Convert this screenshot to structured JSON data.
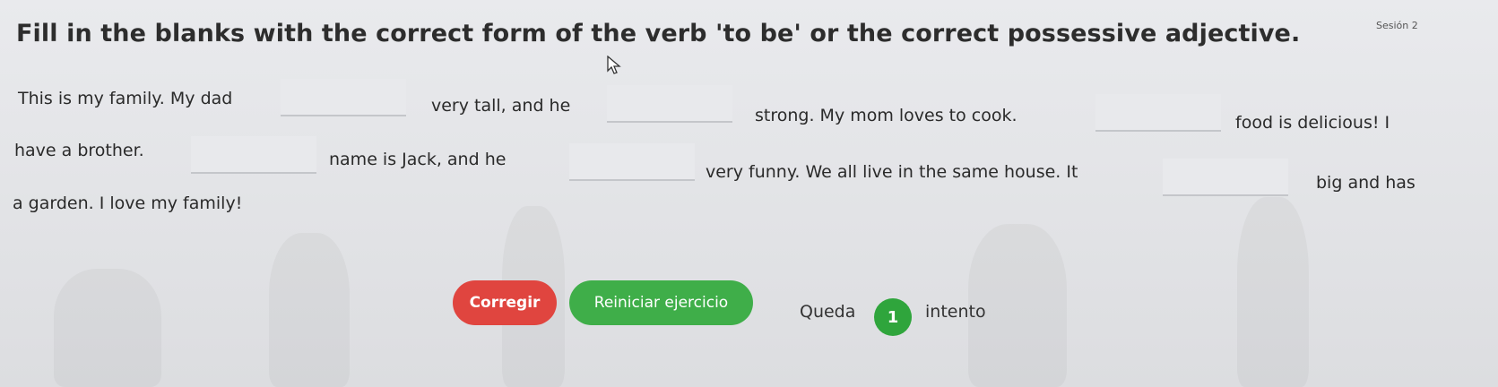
{
  "header": {
    "session_label": "Sesión 2"
  },
  "instructions": "Fill in the blanks with the correct form of the verb 'to be' or the correct possessive adjective.",
  "passage": {
    "seg1": "This is my family. My dad",
    "seg2": "very tall, and he",
    "seg3": "strong. My mom loves to cook.",
    "seg4": "food is delicious! I",
    "seg5": "have a brother.",
    "seg6": "name is Jack, and he",
    "seg7": "very funny. We all live in the same house. It",
    "seg8": "big and has",
    "seg9": "a garden. I love my family!"
  },
  "blanks": [
    "",
    "",
    "",
    "",
    "",
    "",
    ""
  ],
  "controls": {
    "corregir_label": "Corregir",
    "reiniciar_label": "Reiniciar ejercicio",
    "queda_label": "Queda",
    "attempts_remaining": "1",
    "intento_label": "intento"
  },
  "colors": {
    "corregir": "#e0453f",
    "reiniciar": "#3fae49",
    "badge": "#2fa53c"
  },
  "icons": {
    "cursor": "mouse-pointer-icon"
  }
}
